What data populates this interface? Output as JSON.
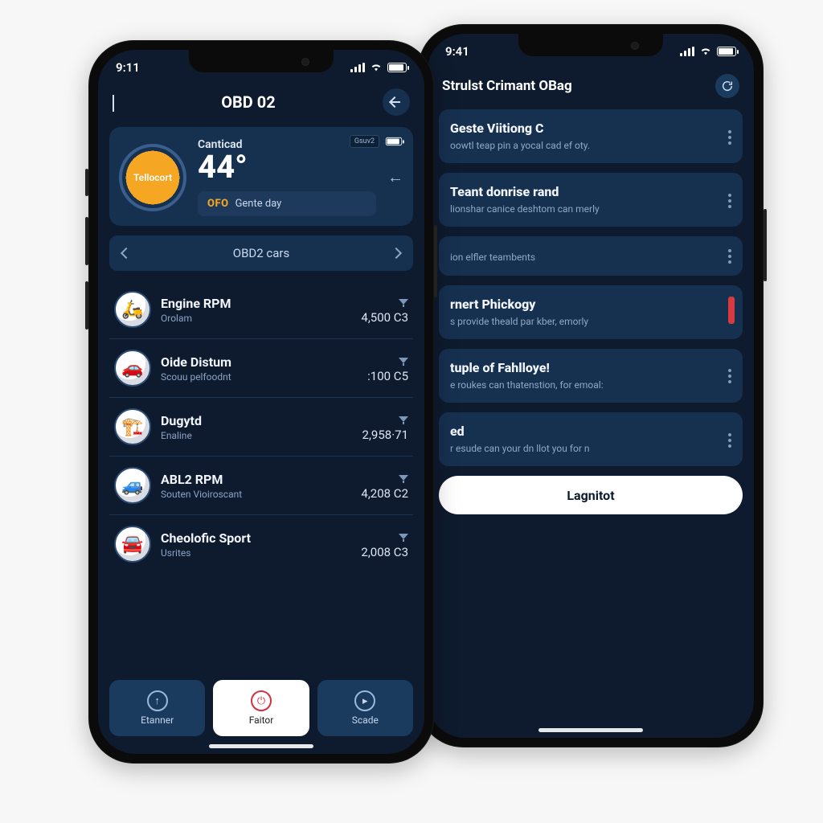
{
  "front": {
    "status": {
      "time": "9:11"
    },
    "nav": {
      "title": "OBD 02"
    },
    "hero": {
      "gauge_label": "Tellocort",
      "label": "Canticad",
      "value": "44°",
      "badge": "Gsuv2",
      "pill_tag": "OFO",
      "pill_text": "Gente day"
    },
    "selector": {
      "label": "OBD2 cars"
    },
    "rows": [
      {
        "title": "Engine RPM",
        "sub": "Orolam",
        "value": "4,500 C3",
        "icon": "🛵"
      },
      {
        "title": "Oide Distum",
        "sub": "Scouu pelfoodnt",
        "value": ":100 C5",
        "icon": "🚗"
      },
      {
        "title": "Dugytd",
        "sub": "Enaline",
        "value": "2,958·71",
        "icon": "🏗️"
      },
      {
        "title": "ABL2 RPM",
        "sub": "Souten Vioiroscant",
        "value": "4,208 C2",
        "icon": "🚙"
      },
      {
        "title": "Cheolofic Sport",
        "sub": "Usrites",
        "value": "2,008 C3",
        "icon": "🚘"
      }
    ],
    "tabs": {
      "left": "Etanner",
      "mid": "Faitor",
      "right": "Scade"
    }
  },
  "back": {
    "status": {
      "time": "9:41"
    },
    "header": {
      "title": "Strulst Crimant OBag"
    },
    "cards": [
      {
        "title": "Geste Viitiong C",
        "sub": "oowtl teap pin a yocal cad ef oty."
      },
      {
        "title": "Teant donrise rand",
        "sub": "lionshar canice deshtom can merly"
      },
      {
        "title": "",
        "sub": "ion elfler teambents"
      },
      {
        "title": "rnert Phickogy",
        "sub": "s provide theald par kber, emorly"
      },
      {
        "title": "tuple of Fahlloye!",
        "sub": "e roukes can thatenstion, for emoal:"
      },
      {
        "title": "ed",
        "sub": "r esude can your dn llot you for n"
      }
    ],
    "cta": "Lagnitot"
  }
}
